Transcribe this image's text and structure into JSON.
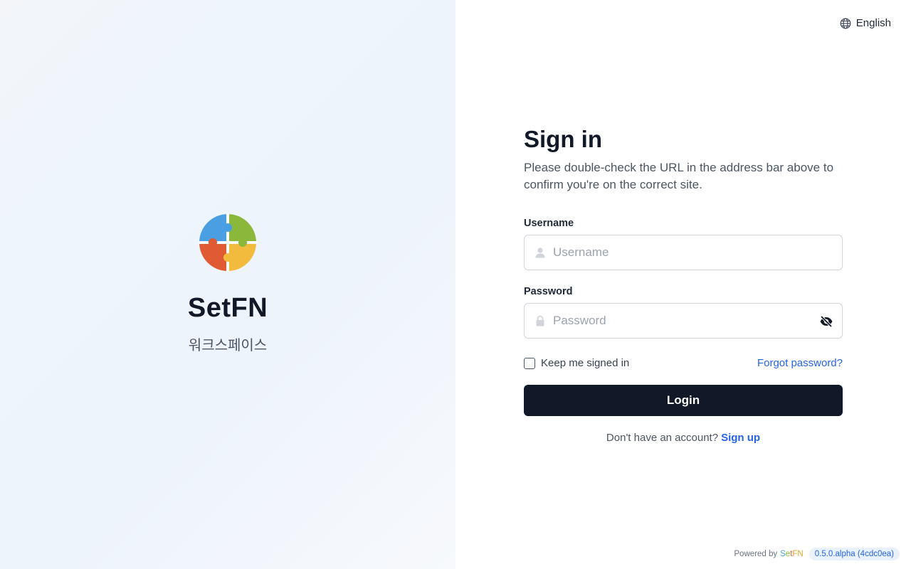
{
  "brand": {
    "name": "SetFN",
    "subtitle": "워크스페이스",
    "logo_colors": {
      "blue": "#4a9ee2",
      "green": "#8bb83a",
      "red": "#e05a34",
      "yellow": "#f2bb3e"
    }
  },
  "language": {
    "label": "English",
    "icon": "globe-icon"
  },
  "form": {
    "title": "Sign in",
    "subtitle": "Please double-check the URL in the address bar above to confirm you're on the correct site.",
    "username": {
      "label": "Username",
      "placeholder": "Username",
      "value": "",
      "icon": "user-icon"
    },
    "password": {
      "label": "Password",
      "placeholder": "Password",
      "value": "",
      "icon": "lock-icon",
      "toggle_icon": "eye-off-icon"
    },
    "remember": {
      "label": "Keep me signed in",
      "checked": false
    },
    "forgot_label": "Forgot password?",
    "login_label": "Login",
    "signup": {
      "prompt": "Don't have an account?",
      "link": "Sign up"
    }
  },
  "footer": {
    "powered_by": "Powered by",
    "brand_parts": [
      "S",
      "e",
      "t",
      "FN"
    ],
    "version": "0.5.0.alpha (4cdc0ea)"
  },
  "colors": {
    "primary_button": "#111827",
    "link": "#2563eb"
  }
}
